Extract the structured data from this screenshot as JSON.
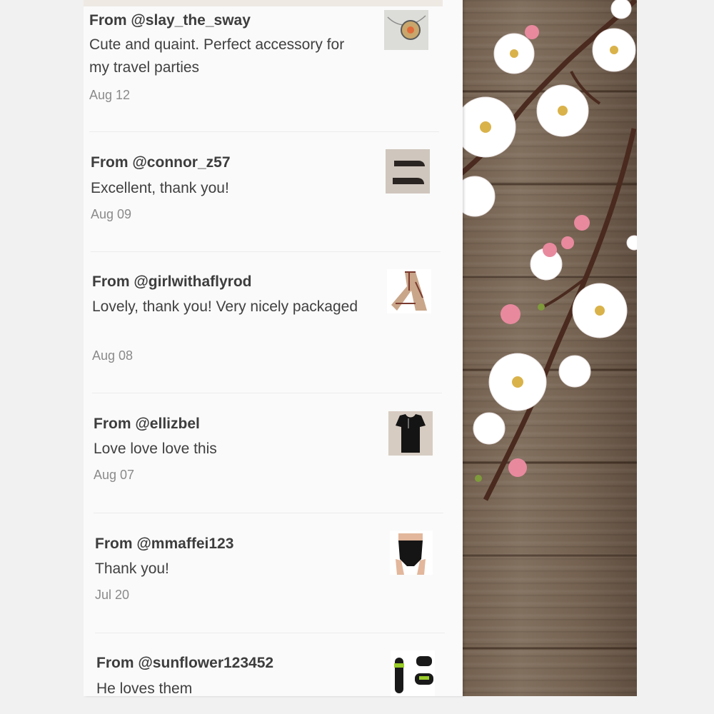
{
  "reviews": [
    {
      "user": "From @slay_the_sway",
      "text": "Cute and quaint. Perfect accessory for my travel parties",
      "date": "Aug 12",
      "thumb_icon": "pendant-necklace-thumbnail"
    },
    {
      "user": "From @connor_z57",
      "text": "Excellent, thank you!",
      "date": "Aug 09",
      "thumb_icon": "black-shoes-thumbnail"
    },
    {
      "user": "From @girlwithaflyrod",
      "text": "Lovely, thank you! Very nicely packaged",
      "date": "Aug 08",
      "thumb_icon": "plaid-scarf-thumbnail"
    },
    {
      "user": "From @ellizbel",
      "text": "Love love love this",
      "date": "Aug 07",
      "thumb_icon": "black-top-thumbnail"
    },
    {
      "user": "From @mmaffei123",
      "text": "Thank you!",
      "date": "Jul 20",
      "thumb_icon": "black-bodysuit-thumbnail"
    },
    {
      "user": "From @sunflower123452",
      "text": "He loves them",
      "date": "",
      "thumb_icon": "kids-sandals-thumbnail"
    }
  ],
  "colors": {
    "card_bg": "#fafafa",
    "username": "#3d3d3d",
    "review_text": "#404040",
    "date": "#8a8a8a",
    "page_bg": "#f1f1f1",
    "wood": "#7a6756",
    "blossom": "#ffffff",
    "bud": "#e8899e"
  }
}
